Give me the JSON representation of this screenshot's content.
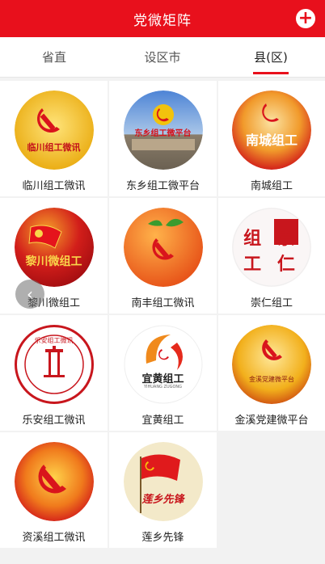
{
  "header": {
    "title": "党微矩阵",
    "add_icon": "plus-circle-icon"
  },
  "tabs": [
    {
      "label": "省直",
      "active": false
    },
    {
      "label": "设区市",
      "active": false
    },
    {
      "label": "县(区)",
      "active": true
    }
  ],
  "accounts": [
    {
      "name": "临川组工微讯",
      "logo_text": "临川组工微讯",
      "icon": "party-emblem-logo"
    },
    {
      "name": "东乡组工微平台",
      "logo_text": "东乡组工微平台",
      "icon": "party-emblem-building-logo"
    },
    {
      "name": "南城组工",
      "logo_text": "南城组工",
      "icon": "party-emblem-logo"
    },
    {
      "name": "黎川微组工",
      "logo_text": "黎川微组工",
      "icon": "party-flag-logo"
    },
    {
      "name": "南丰组工微讯",
      "logo_text": "",
      "icon": "tangerine-emblem-logo"
    },
    {
      "name": "崇仁组工",
      "logo_text_top": "组 崇",
      "logo_text_bottom": "工 仁",
      "icon": "calligraphy-logo"
    },
    {
      "name": "乐安组工微讯",
      "logo_text": "乐安组工微讯",
      "icon": "seal-logo"
    },
    {
      "name": "宜黄组工",
      "logo_text": "宜黄组工",
      "logo_subtext": "YIHUANG ZUGONG",
      "icon": "swirl-emblem-logo"
    },
    {
      "name": "金溪党建微平台",
      "logo_text": "金溪党建微平台",
      "icon": "party-emblem-logo"
    },
    {
      "name": "资溪组工微讯",
      "logo_text": "",
      "icon": "party-emblem-logo"
    },
    {
      "name": "莲乡先锋",
      "logo_text": "莲乡先锋",
      "icon": "flag-calligraphy-logo"
    }
  ],
  "carousel": {
    "prev_icon": "chevron-left-icon",
    "prev_glyph": "‹"
  },
  "colors": {
    "primary": "#e8101c",
    "gold": "#f6c20c"
  }
}
